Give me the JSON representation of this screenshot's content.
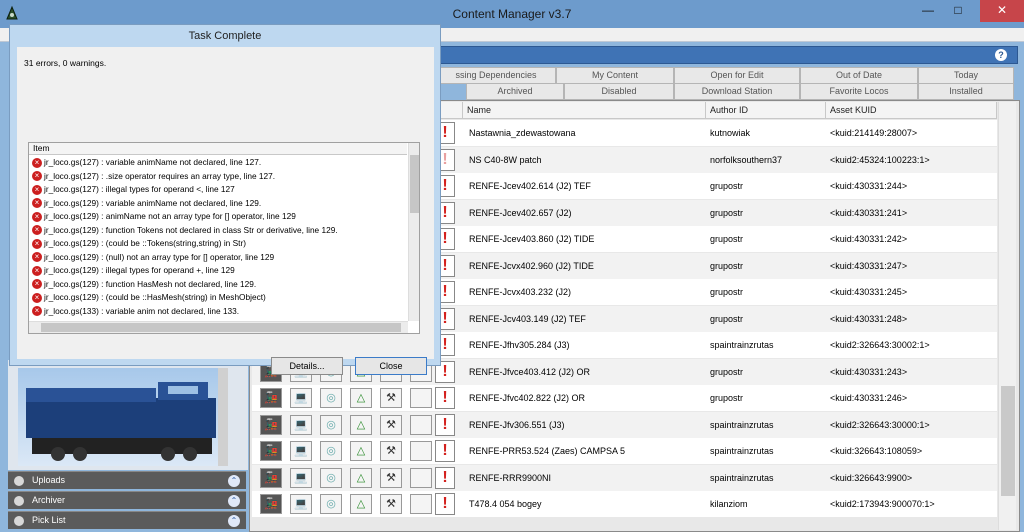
{
  "window": {
    "title": "Content Manager v3.7",
    "min_label": "—",
    "max_label": "□",
    "close_label": "✕"
  },
  "help_label": "?",
  "tabs_row1": [
    "ssing Dependencies",
    "My Content",
    "Open for Edit",
    "Out of Date",
    "Today"
  ],
  "tabs_row2": [
    "Archived",
    "Disabled",
    "Download Station",
    "Favorite Locos",
    "Installed"
  ],
  "columns": {
    "name": "Name",
    "author": "Author ID",
    "kuid": "Asset KUID"
  },
  "rows": [
    {
      "name": "Nastawnia_zdewastowana",
      "author": "kutnowiak",
      "kuid": "<kuid:214149:28007>"
    },
    {
      "name": "NS C40-8W patch",
      "author": "norfolksouthern37",
      "kuid": "<kuid2:45324:100223:1>"
    },
    {
      "name": "RENFE-Jcev402.614 (J2) TEF",
      "author": "grupostr",
      "kuid": "<kuid:430331:244>"
    },
    {
      "name": "RENFE-Jcev402.657 (J2)",
      "author": "grupostr",
      "kuid": "<kuid:430331:241>"
    },
    {
      "name": "RENFE-Jcev403.860 (J2) TIDE",
      "author": "grupostr",
      "kuid": "<kuid:430331:242>"
    },
    {
      "name": "RENFE-Jcvx402.960 (J2) TIDE",
      "author": "grupostr",
      "kuid": "<kuid:430331:247>"
    },
    {
      "name": "RENFE-Jcvx403.232 (J2)",
      "author": "grupostr",
      "kuid": "<kuid:430331:245>"
    },
    {
      "name": "RENFE-Jcv403.149 (J2) TEF",
      "author": "grupostr",
      "kuid": "<kuid:430331:248>"
    },
    {
      "name": "RENFE-Jfhv305.284 (J3)",
      "author": "spaintrainzrutas",
      "kuid": "<kuid2:326643:30002:1>"
    },
    {
      "name": "RENFE-Jfvce403.412 (J2) OR",
      "author": "grupostr",
      "kuid": "<kuid:430331:243>"
    },
    {
      "name": "RENFE-Jfvc402.822 (J2) OR",
      "author": "grupostr",
      "kuid": "<kuid:430331:246>"
    },
    {
      "name": "RENFE-Jfv306.551 (J3)",
      "author": "spaintrainzrutas",
      "kuid": "<kuid2:326643:30000:1>"
    },
    {
      "name": "RENFE-PRR53.524 (Zaes) CAMPSA 5",
      "author": "spaintrainzrutas",
      "kuid": "<kuid:326643:108059>"
    },
    {
      "name": "RENFE-RRR9900NI",
      "author": "spaintrainzrutas",
      "kuid": "<kuid:326643:9900>"
    },
    {
      "name": "T478.4 054 bogey",
      "author": "kilanziom",
      "kuid": "<kuid2:173943:900070:1>"
    }
  ],
  "side": {
    "accordions": [
      "Uploads",
      "Archiver",
      "Pick List"
    ]
  },
  "dialog": {
    "title": "Task Complete",
    "summary": "31 errors, 0 warnings.",
    "list_header": "Item",
    "items": [
      "jr_loco.gs(127) : variable animName not declared, line 127.",
      "jr_loco.gs(127) : .size operator requires an array type, line 127.",
      "jr_loco.gs(127) : illegal types for operand <, line 127",
      "jr_loco.gs(129) : variable animName not declared, line 129.",
      "jr_loco.gs(129) : animName not an array type for [] operator, line 129",
      "jr_loco.gs(129) : function Tokens not declared in class Str or derivative, line 129.",
      "jr_loco.gs(129) : (could be ::Tokens(string,string) in Str)",
      "jr_loco.gs(129) : (null) not an array type for [] operator, line 129",
      "jr_loco.gs(129) : illegal types for operand +, line 129",
      "jr_loco.gs(129) : function HasMesh not declared, line 129.",
      "jr_loco.gs(129) : (could be ::HasMesh(string) in MeshObject)",
      "jr_loco.gs(133) : variable anim not declared, line 133."
    ],
    "details_label": "Details...",
    "close_label": "Close"
  }
}
